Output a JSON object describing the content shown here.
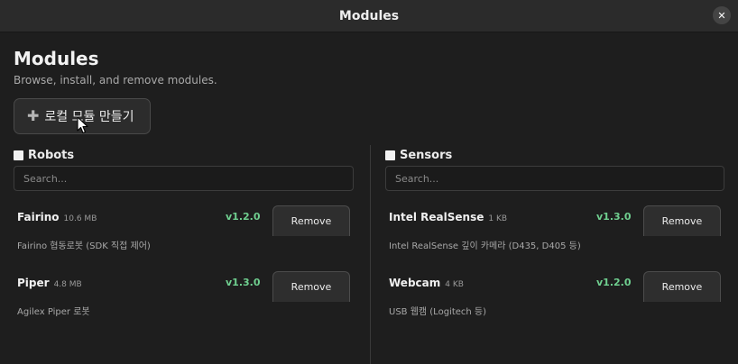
{
  "window": {
    "title": "Modules",
    "close_glyph": "✕"
  },
  "page": {
    "heading": "Modules",
    "subheading": "Browse, install, and remove modules.",
    "create_button": {
      "icon": "plus-icon",
      "label": "로컬 모듈 만들기"
    }
  },
  "robots": {
    "title": "Robots",
    "search_placeholder": "Search...",
    "modules": [
      {
        "name": "Fairino",
        "size": "10.6 MB",
        "version": "v1.2.0",
        "description": "Fairino 협동로봇 (SDK 직접 제어)",
        "action": "Remove"
      },
      {
        "name": "Piper",
        "size": "4.8 MB",
        "version": "v1.3.0",
        "description": "Agilex Piper 로봇",
        "action": "Remove"
      }
    ]
  },
  "sensors": {
    "title": "Sensors",
    "search_placeholder": "Search...",
    "modules": [
      {
        "name": "Intel RealSense",
        "size": "1 KB",
        "version": "v1.3.0",
        "description": "Intel RealSense 깊이 카메라 (D435, D405 등)",
        "action": "Remove"
      },
      {
        "name": "Webcam",
        "size": "4 KB",
        "version": "v1.2.0",
        "description": "USB 웹캠 (Logitech 등)",
        "action": "Remove"
      }
    ]
  },
  "colors": {
    "background": "#1e1e1e",
    "titlebar": "#2b2b2b",
    "version_green": "#6fcf8f"
  }
}
